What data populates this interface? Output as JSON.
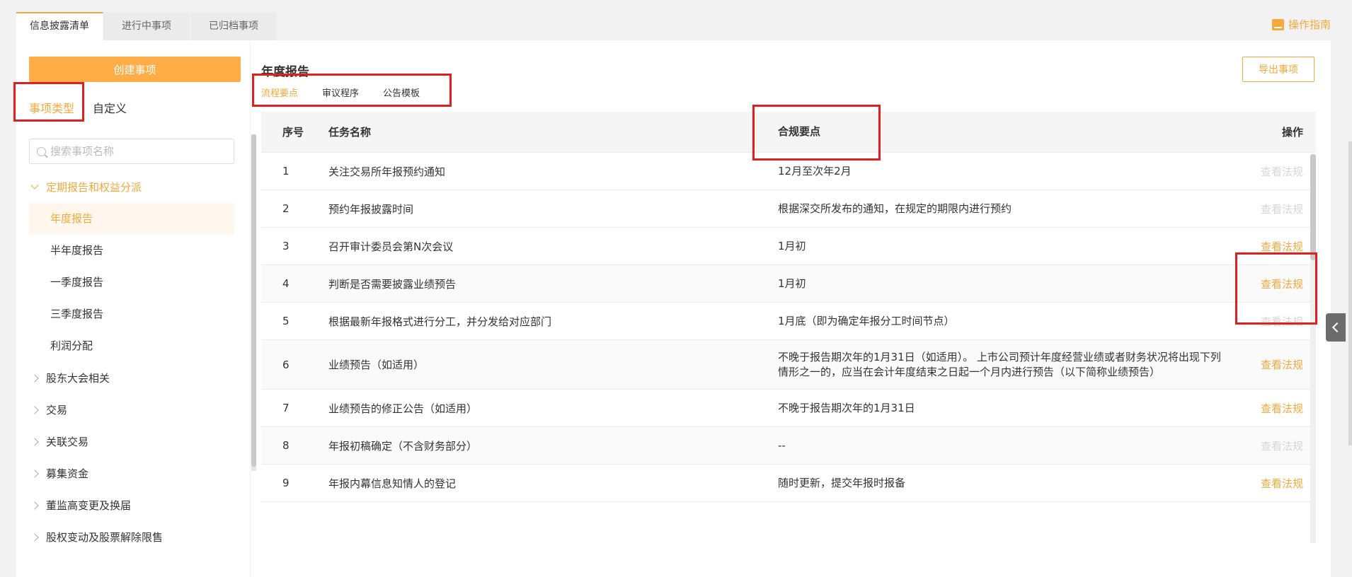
{
  "top_tabs": [
    {
      "label": "信息披露清单",
      "active": true
    },
    {
      "label": "进行中事项",
      "active": false
    },
    {
      "label": "已归档事项",
      "active": false
    }
  ],
  "guide": {
    "label": "操作指南",
    "icon": "book-icon"
  },
  "sidebar": {
    "create_label": "创建事项",
    "tabs": [
      {
        "label": "事项类型",
        "active": true
      },
      {
        "label": "自定义",
        "active": false
      }
    ],
    "search": {
      "placeholder": "搜索事项名称",
      "value": ""
    },
    "groups": [
      {
        "label": "定期报告和权益分派",
        "open": true,
        "children": [
          {
            "label": "年度报告",
            "active": true
          },
          {
            "label": "半年度报告",
            "active": false
          },
          {
            "label": "一季度报告",
            "active": false
          },
          {
            "label": "三季度报告",
            "active": false
          },
          {
            "label": "利润分配",
            "active": false
          }
        ]
      },
      {
        "label": "股东大会相关",
        "open": false
      },
      {
        "label": "交易",
        "open": false
      },
      {
        "label": "关联交易",
        "open": false
      },
      {
        "label": "募集资金",
        "open": false
      },
      {
        "label": "董监高变更及换届",
        "open": false
      },
      {
        "label": "股权变动及股票解除限售",
        "open": false
      }
    ]
  },
  "content": {
    "title": "年度报告",
    "export_label": "导出事项",
    "sub_tabs": [
      {
        "label": "流程要点",
        "active": true
      },
      {
        "label": "审议程序",
        "active": false
      },
      {
        "label": "公告模板",
        "active": false
      }
    ],
    "table": {
      "headers": [
        "序号",
        "任务名称",
        "合规要点",
        "操作"
      ],
      "rows": [
        {
          "num": "1",
          "name": "关注交易所年报预约通知",
          "point": "12月至次年2月",
          "op": "查看法规",
          "enabled": false
        },
        {
          "num": "2",
          "name": "预约年报披露时间",
          "point": "根据深交所发布的通知，在规定的期限内进行预约",
          "op": "查看法规",
          "enabled": false
        },
        {
          "num": "3",
          "name": "召开审计委员会第N次会议",
          "point": "1月初",
          "op": "查看法规",
          "enabled": true
        },
        {
          "num": "4",
          "name": "判断是否需要披露业绩预告",
          "point": "1月初",
          "op": "查看法规",
          "enabled": true
        },
        {
          "num": "5",
          "name": "根据最新年报格式进行分工，并分发给对应部门",
          "point": "1月底（即为确定年报分工时间节点）",
          "op": "查看法规",
          "enabled": false
        },
        {
          "num": "6",
          "name": "业绩预告（如适用）",
          "point": "不晚于报告期次年的1月31日（如适用）。 上市公司预计年度经营业绩或者财务状况将出现下列情形之一的，应当在会计年度结束之日起一个月内进行预告（以下简称业绩预告）",
          "op": "查看法规",
          "enabled": true
        },
        {
          "num": "7",
          "name": "业绩预告的修正公告（如适用）",
          "point": "不晚于报告期次年的1月31日",
          "op": "查看法规",
          "enabled": true
        },
        {
          "num": "8",
          "name": "年报初稿确定（不含财务部分）",
          "point": "--",
          "op": "查看法规",
          "enabled": false
        },
        {
          "num": "9",
          "name": "年报内幕信息知情人的登记",
          "point": "随时更新，提交年报时报备",
          "op": "查看法规",
          "enabled": true
        }
      ]
    }
  },
  "colors": {
    "accent": "#f7a83a",
    "annotation": "#e02020"
  }
}
